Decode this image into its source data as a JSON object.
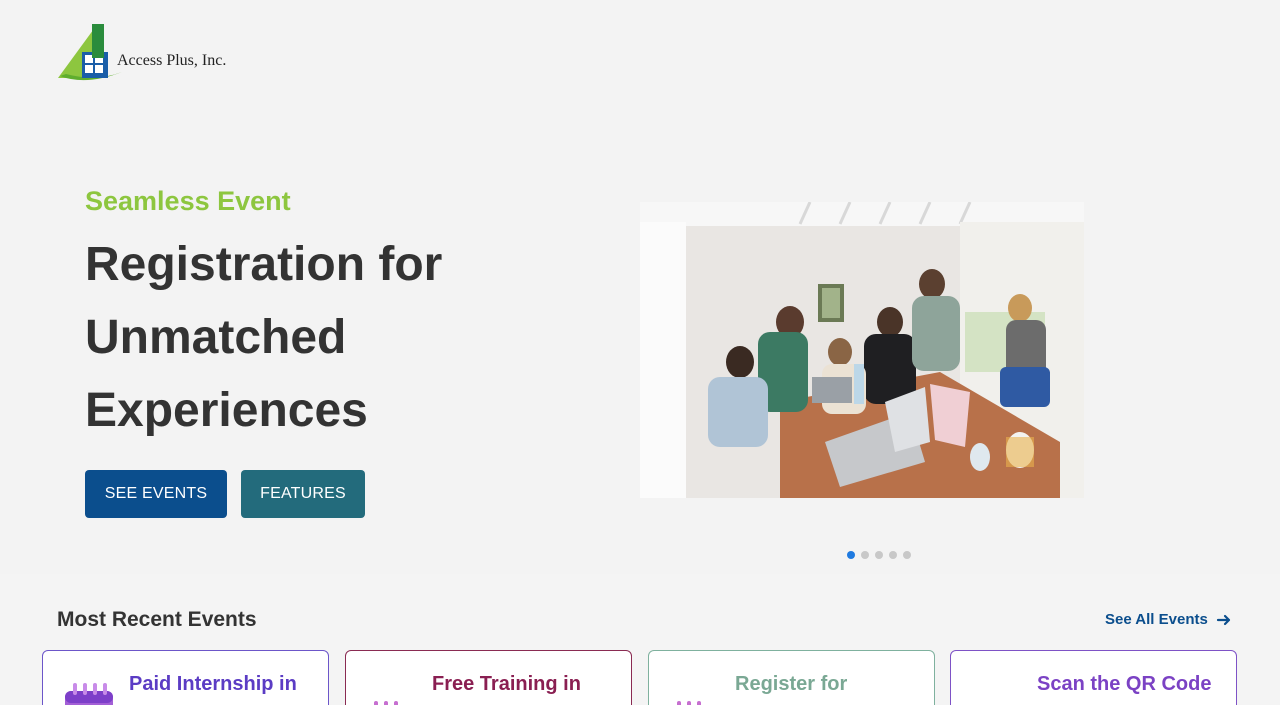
{
  "brand": {
    "name": "Access Plus, Inc.",
    "colors": {
      "green": "#8dc63f",
      "blue": "#0b4e8d",
      "teal": "#236b7c"
    }
  },
  "hero": {
    "kicker": "Seamless Event",
    "headline": "Registration for Unmatched Experiences",
    "buttons": {
      "see_events": "SEE EVENTS",
      "features": "FEATURES"
    },
    "carousel": {
      "slides": 5,
      "active_index": 0
    }
  },
  "recent": {
    "title": "Most Recent Events",
    "see_all": "See All Events",
    "cards": [
      {
        "title": "Paid Internship in",
        "color": "#5b3cc4",
        "border": "#6c56c9",
        "icon": "calendar-icon"
      },
      {
        "title": "Free Training in",
        "color": "#8a1f52",
        "border": "#8a2b52",
        "icon": "calendar-icon"
      },
      {
        "title": "Register for",
        "color": "#7aa894",
        "border": "#7fb19e",
        "icon": "calendar-icon"
      },
      {
        "title": "Scan the QR Code",
        "color": "#7b42c4",
        "border": "#7e52c6",
        "icon": "qr-icon"
      }
    ]
  }
}
